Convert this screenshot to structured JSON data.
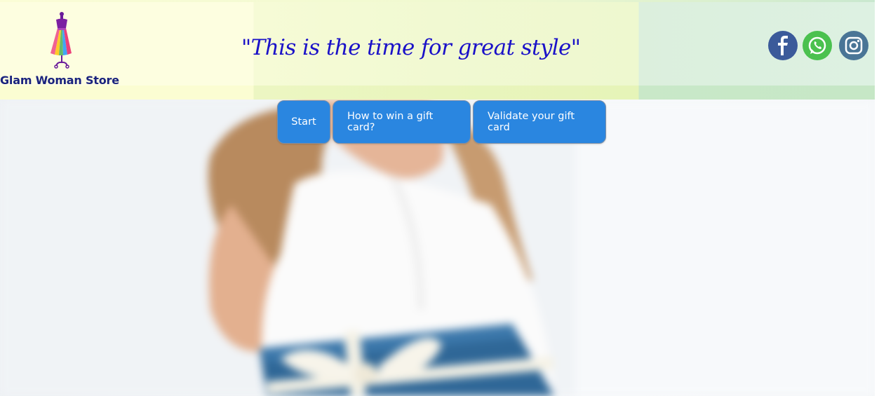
{
  "header": {
    "logo": {
      "icon": "dress-mannequin-logo",
      "name": "Glam Woman Store"
    },
    "slogan": "\"This is the time for great style\"",
    "social": [
      {
        "icon": "facebook-icon",
        "color": "#3b5a9a"
      },
      {
        "icon": "whatsapp-icon",
        "color": "#4bc14f"
      },
      {
        "icon": "instagram-icon",
        "color": "#4a7596"
      }
    ]
  },
  "nav": {
    "items": [
      {
        "label": "Start"
      },
      {
        "label": "How to win a gift card?"
      },
      {
        "label": "Validate your gift card"
      }
    ]
  },
  "hero": {
    "image": "woman-holding-blue-gift-box"
  },
  "colors": {
    "nav_button": "#2a86e0",
    "slogan": "#1a11c8",
    "logo_text": "#1a237e"
  }
}
